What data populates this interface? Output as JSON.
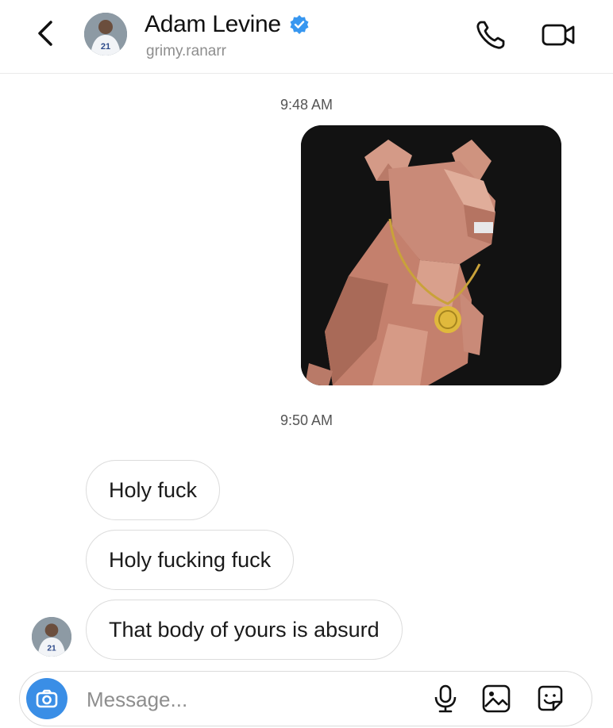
{
  "header": {
    "name": "Adam Levine",
    "handle": "grimy.ranarr"
  },
  "conversation": {
    "timestamps": [
      "9:48 AM",
      "9:50 AM"
    ],
    "messages": [
      "Holy fuck",
      "Holy fucking fuck",
      "That body of yours is absurd"
    ],
    "avatar_jersey_number": "21"
  },
  "composer": {
    "placeholder": "Message..."
  },
  "colors": {
    "verified_badge": "#3897f0",
    "camera_button": "#3a8ee6",
    "photo_background": "#111111",
    "figure_pink": "#c98a78"
  },
  "icons": [
    "chevron-left-icon",
    "verified-badge-icon",
    "phone-icon",
    "video-camera-icon",
    "camera-icon",
    "microphone-icon",
    "gallery-icon",
    "sticker-icon"
  ]
}
